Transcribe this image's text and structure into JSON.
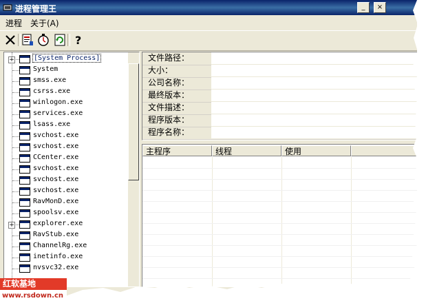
{
  "window": {
    "title": "进程管理王"
  },
  "titlebar_buttons": {
    "minimize": "_",
    "close": "×"
  },
  "menu": {
    "items": [
      {
        "label": "进程"
      },
      {
        "label": "关于(A)"
      }
    ]
  },
  "toolbar": {
    "tools": [
      "close-process-icon",
      "process-properties-icon",
      "timer-icon",
      "refresh-icon",
      "help-icon"
    ],
    "help_glyph": "?"
  },
  "process_tree": {
    "items": [
      {
        "label": "[System Process]",
        "expandable": true,
        "selected": true
      },
      {
        "label": "System"
      },
      {
        "label": "smss.exe"
      },
      {
        "label": "csrss.exe"
      },
      {
        "label": "winlogon.exe"
      },
      {
        "label": "services.exe"
      },
      {
        "label": "lsass.exe"
      },
      {
        "label": "svchost.exe"
      },
      {
        "label": "svchost.exe"
      },
      {
        "label": "CCenter.exe"
      },
      {
        "label": "svchost.exe"
      },
      {
        "label": "svchost.exe"
      },
      {
        "label": "svchost.exe"
      },
      {
        "label": "RavMonD.exe"
      },
      {
        "label": "spoolsv.exe"
      },
      {
        "label": "explorer.exe",
        "expandable": true
      },
      {
        "label": "RavStub.exe"
      },
      {
        "label": "ChannelRg.exe"
      },
      {
        "label": "inetinfo.exe"
      },
      {
        "label": "nvsvc32.exe"
      }
    ]
  },
  "info_panel": {
    "fields": [
      {
        "label": "文件路径：",
        "value": ""
      },
      {
        "label": "大小：",
        "value": ""
      },
      {
        "label": "公司名称：",
        "value": ""
      },
      {
        "label": "最终版本：",
        "value": ""
      },
      {
        "label": "文件描述：",
        "value": ""
      },
      {
        "label": "程序版本：",
        "value": ""
      },
      {
        "label": "程序名称：",
        "value": ""
      }
    ]
  },
  "module_list": {
    "columns": [
      {
        "label": "主程序"
      },
      {
        "label": "线程"
      },
      {
        "label": "使用"
      }
    ]
  },
  "watermark": {
    "line1": "红软基地",
    "line2": "www.rsdown.cn"
  },
  "colors": {
    "titlebar": "#0a246a",
    "face": "#ece9d8",
    "watermark_red": "#e23a28"
  }
}
